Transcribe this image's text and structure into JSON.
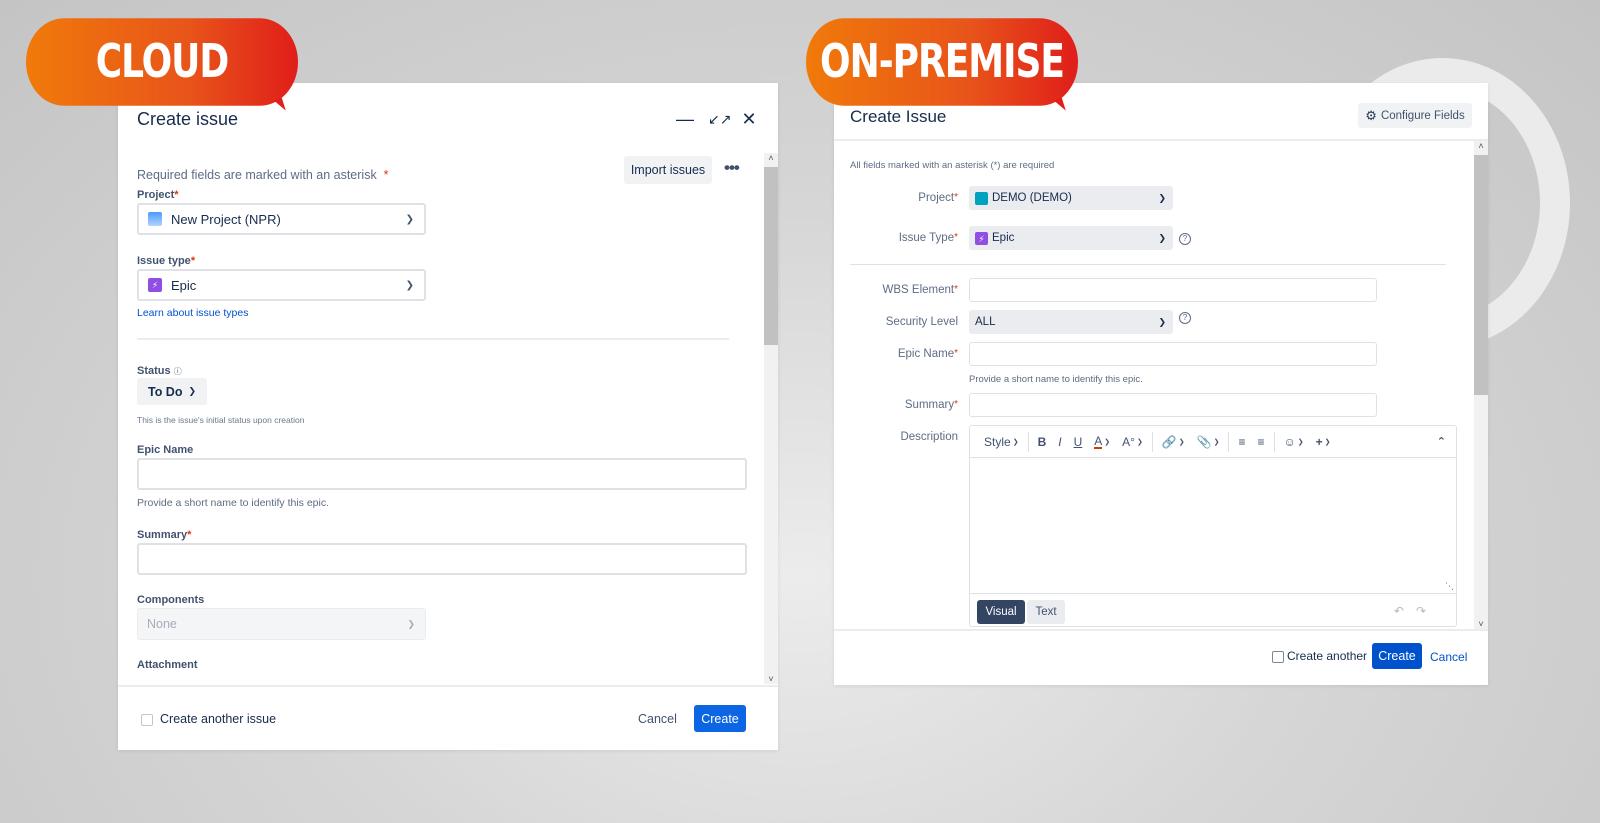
{
  "badges": {
    "cloud": "CLOUD",
    "onprem": "ON-PREMISE"
  },
  "cloud": {
    "title": "Create issue",
    "header_icons": [
      "minimize-icon",
      "collapse-arrows-icon",
      "close-icon"
    ],
    "required_note": "Required fields are marked with an asterisk",
    "asterisk": "*",
    "import_button": "Import issues",
    "more_button": "•••",
    "project": {
      "label": "Project",
      "value": "New Project (NPR)"
    },
    "issue_type": {
      "label": "Issue type",
      "value": "Epic",
      "link": "Learn about issue types"
    },
    "status": {
      "label": "Status",
      "value": "To Do",
      "help": "This is the issue's initial status upon creation"
    },
    "epic_name": {
      "label": "Epic Name",
      "value": "",
      "help": "Provide a short name to identify this epic."
    },
    "summary": {
      "label": "Summary",
      "value": ""
    },
    "components": {
      "label": "Components",
      "value": "None"
    },
    "attachment": {
      "label": "Attachment"
    },
    "footer": {
      "create_another": "Create another issue",
      "cancel": "Cancel",
      "create": "Create"
    }
  },
  "onprem": {
    "title": "Create Issue",
    "configure_button": "Configure Fields",
    "required_note": "All fields marked with an asterisk (*) are required",
    "project": {
      "label": "Project",
      "value": "DEMO (DEMO)"
    },
    "issue_type": {
      "label": "Issue Type",
      "value": "Epic"
    },
    "wbs": {
      "label": "WBS Element",
      "value": ""
    },
    "security": {
      "label": "Security Level",
      "value": "ALL"
    },
    "epic_name": {
      "label": "Epic Name",
      "value": "",
      "help": "Provide a short name to identify this epic."
    },
    "summary": {
      "label": "Summary",
      "value": ""
    },
    "description": {
      "label": "Description",
      "toolbar": {
        "style": "Style",
        "bold": "B",
        "italic": "I",
        "underline": "U",
        "color": "A"
      },
      "tabs": {
        "visual": "Visual",
        "text": "Text"
      }
    },
    "footer": {
      "create_another": "Create another",
      "create": "Create",
      "cancel": "Cancel"
    }
  }
}
